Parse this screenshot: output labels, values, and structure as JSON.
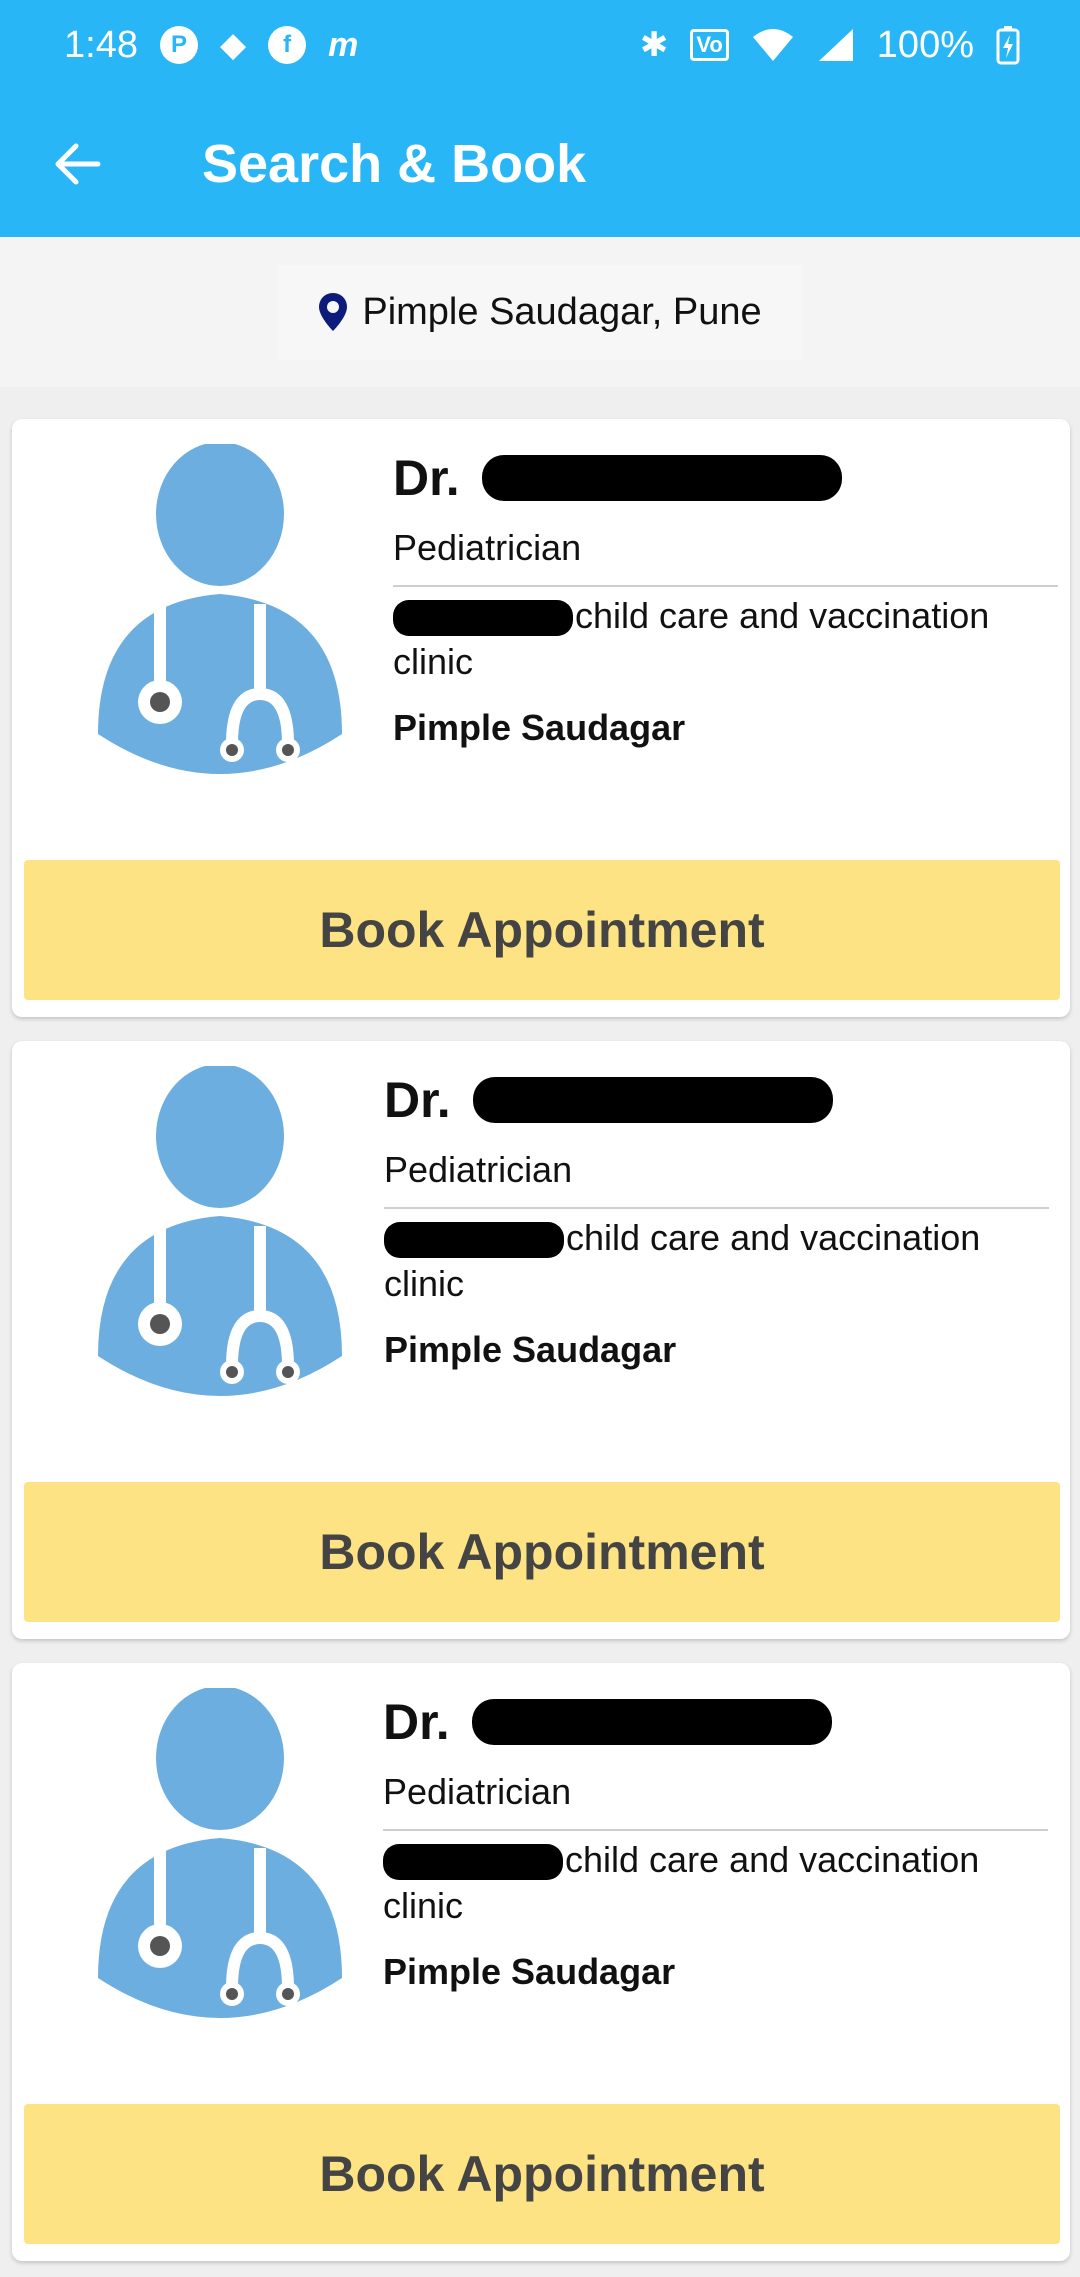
{
  "status_bar": {
    "time": "1:48",
    "battery": "100%",
    "left_icons": [
      "p-icon",
      "dropbox-icon",
      "facebook-icon",
      "myntra-icon"
    ],
    "right_icons": [
      "bluetooth-icon",
      "volte-icon",
      "wifi-icon",
      "signal-icon",
      "battery-charging-icon"
    ]
  },
  "toolbar": {
    "title": "Search & Book",
    "back_icon": "arrow-left-icon"
  },
  "location": {
    "text": "Pimple Saudagar, Pune",
    "icon": "map-pin-icon"
  },
  "colors": {
    "appbar": "#29b6f6",
    "book_button": "#fde383",
    "avatar": "#6daee0"
  },
  "doctors": [
    {
      "name_prefix": "Dr.",
      "specialty": "Pediatrician",
      "clinic": "child care and vaccination clinic",
      "area": "Pimple Saudagar",
      "button": "Book Appointment"
    },
    {
      "name_prefix": "Dr.",
      "specialty": "Pediatrician",
      "clinic": "child care and vaccination clinic",
      "area": "Pimple Saudagar",
      "button": "Book Appointment"
    },
    {
      "name_prefix": "Dr.",
      "specialty": "Pediatrician",
      "clinic": "child care and vaccination clinic",
      "area": "Pimple Saudagar",
      "button": "Book Appointment"
    }
  ]
}
